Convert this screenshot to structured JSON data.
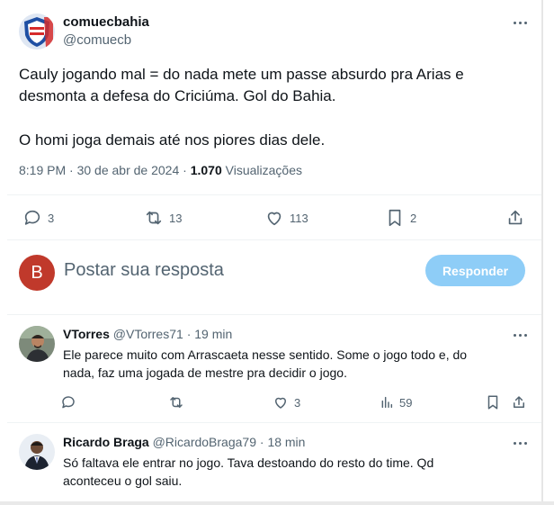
{
  "tweet": {
    "author_name": "comuecbahia",
    "author_handle": "@comuecb",
    "text_line1": "Cauly jogando mal = do nada mete um passe absurdo pra Arias e",
    "text_line2": "desmonta a defesa do Criciúma. Gol do Bahia.",
    "text_line3": "O homi joga demais até nos piores dias dele.",
    "time": "8:19 PM",
    "date": "30 de abr de 2024",
    "views_count": "1.070",
    "views_label": "Visualizações",
    "reply_count": "3",
    "retweet_count": "13",
    "like_count": "113",
    "bookmark_count": "2"
  },
  "composer": {
    "avatar_letter": "B",
    "placeholder": "Postar sua resposta",
    "button_label": "Responder"
  },
  "replies": [
    {
      "name": "VTorres",
      "handle": "@VTorres71",
      "time": "19 min",
      "text_line1": "Ele parece muito com Arrascaeta nesse sentido. Some o jogo todo e, do",
      "text_line2": "nada, faz uma jogada de mestre pra decidir o jogo.",
      "like_count": "3",
      "views_count": "59"
    },
    {
      "name": "Ricardo Braga",
      "handle": "@RicardoBraga79",
      "time": "18 min",
      "text_line1": "Só faltava ele entrar no jogo. Tava destoando do resto do time. Qd",
      "text_line2": "aconteceu o gol saiu."
    }
  ],
  "colors": {
    "accent_button": "#8ecdf7",
    "composer_avatar": "#c0392b",
    "secondary_text": "#536471"
  }
}
